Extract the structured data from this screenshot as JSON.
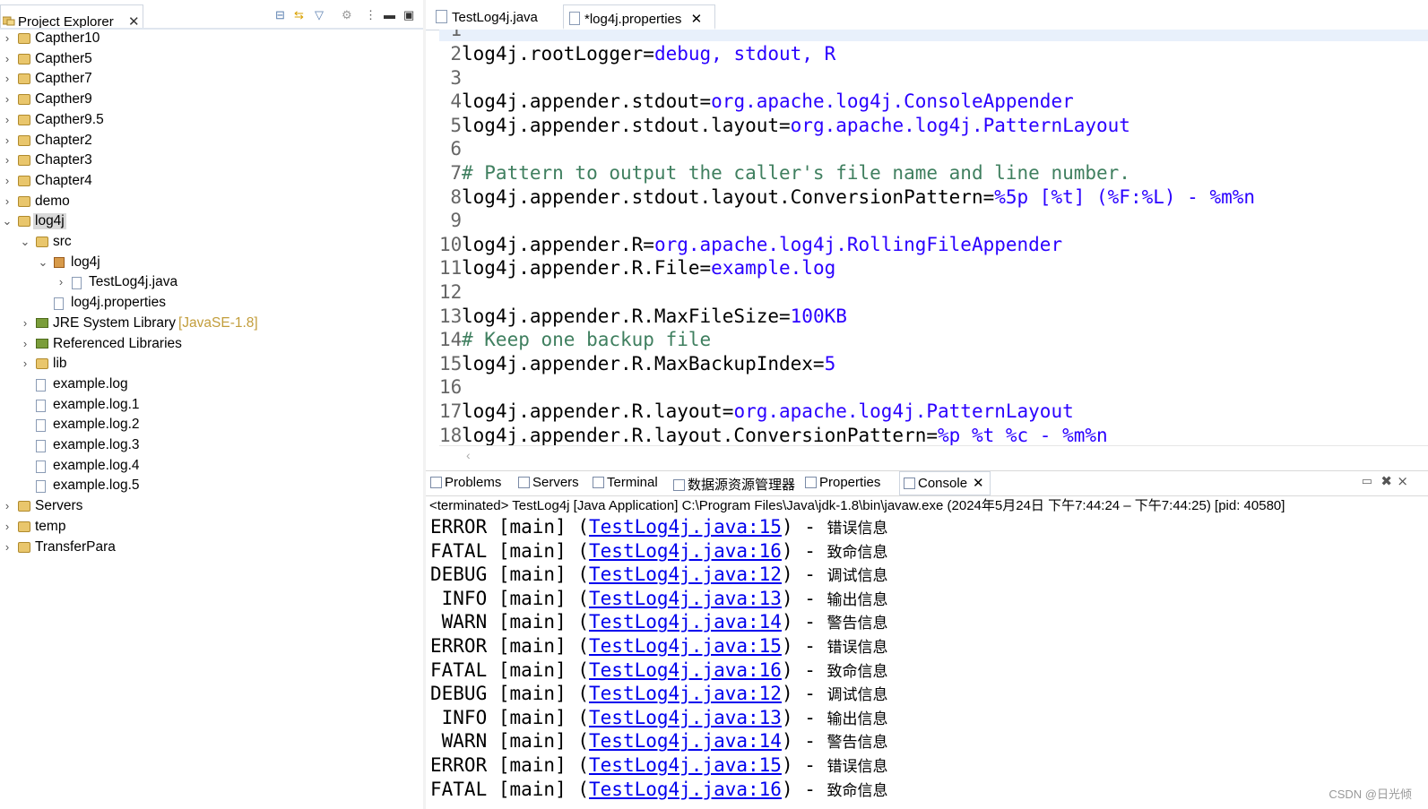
{
  "explorer": {
    "title": "Project Explorer",
    "items": [
      {
        "label": "Capther10",
        "arrow": "›",
        "indent": 0,
        "kind": "project"
      },
      {
        "label": "Capther5",
        "arrow": "›",
        "indent": 0,
        "kind": "project"
      },
      {
        "label": "Capther7",
        "arrow": "›",
        "indent": 0,
        "kind": "project"
      },
      {
        "label": "Capther9",
        "arrow": "›",
        "indent": 0,
        "kind": "project"
      },
      {
        "label": "Capther9.5",
        "arrow": "›",
        "indent": 0,
        "kind": "project"
      },
      {
        "label": "Chapter2",
        "arrow": "›",
        "indent": 0,
        "kind": "project"
      },
      {
        "label": "Chapter3",
        "arrow": "›",
        "indent": 0,
        "kind": "project"
      },
      {
        "label": "Chapter4",
        "arrow": "›",
        "indent": 0,
        "kind": "project"
      },
      {
        "label": "demo",
        "arrow": "›",
        "indent": 0,
        "kind": "project"
      },
      {
        "label": "log4j",
        "arrow": "⌄",
        "indent": 0,
        "kind": "project",
        "selected": true
      },
      {
        "label": "src",
        "arrow": "⌄",
        "indent": 1,
        "kind": "srcfolder"
      },
      {
        "label": "log4j",
        "arrow": "⌄",
        "indent": 2,
        "kind": "package"
      },
      {
        "label": "TestLog4j.java",
        "arrow": "›",
        "indent": 3,
        "kind": "java"
      },
      {
        "label": "log4j.properties",
        "arrow": "",
        "indent": 2,
        "kind": "file"
      },
      {
        "label": "JRE System Library",
        "deco": "[JavaSE-1.8]",
        "arrow": "›",
        "indent": 1,
        "kind": "library"
      },
      {
        "label": "Referenced Libraries",
        "arrow": "›",
        "indent": 1,
        "kind": "library"
      },
      {
        "label": "lib",
        "arrow": "›",
        "indent": 1,
        "kind": "folder"
      },
      {
        "label": "example.log",
        "arrow": "",
        "indent": 1,
        "kind": "file"
      },
      {
        "label": "example.log.1",
        "arrow": "",
        "indent": 1,
        "kind": "file"
      },
      {
        "label": "example.log.2",
        "arrow": "",
        "indent": 1,
        "kind": "file"
      },
      {
        "label": "example.log.3",
        "arrow": "",
        "indent": 1,
        "kind": "file"
      },
      {
        "label": "example.log.4",
        "arrow": "",
        "indent": 1,
        "kind": "file"
      },
      {
        "label": "example.log.5",
        "arrow": "",
        "indent": 1,
        "kind": "file"
      },
      {
        "label": "Servers",
        "arrow": "›",
        "indent": 0,
        "kind": "project"
      },
      {
        "label": "temp",
        "arrow": "›",
        "indent": 0,
        "kind": "project"
      },
      {
        "label": "TransferPara",
        "arrow": "›",
        "indent": 0,
        "kind": "project"
      }
    ]
  },
  "editor": {
    "tabs": [
      {
        "label": "TestLog4j.java",
        "active": false
      },
      {
        "label": "*log4j.properties",
        "active": true
      }
    ],
    "lines": [
      {
        "n": "2",
        "parts": [
          [
            "key",
            "log4j.rootLogger="
          ],
          [
            "val",
            "debug, stdout, R"
          ]
        ]
      },
      {
        "n": "3",
        "parts": []
      },
      {
        "n": "4",
        "parts": [
          [
            "key",
            "log4j.appender.stdout="
          ],
          [
            "val",
            "org.apache.log4j.ConsoleAppender"
          ]
        ]
      },
      {
        "n": "5",
        "parts": [
          [
            "key",
            "log4j.appender.stdout.layout="
          ],
          [
            "val",
            "org.apache.log4j.PatternLayout"
          ]
        ]
      },
      {
        "n": "6",
        "parts": []
      },
      {
        "n": "7",
        "parts": [
          [
            "cmt",
            "# Pattern to output the caller's file name and line number."
          ]
        ]
      },
      {
        "n": "8",
        "parts": [
          [
            "key",
            "log4j.appender.stdout.layout.ConversionPattern="
          ],
          [
            "val",
            "%5p [%t] (%F:%L) - %m%n"
          ]
        ]
      },
      {
        "n": "9",
        "parts": []
      },
      {
        "n": "10",
        "parts": [
          [
            "key",
            "log4j.appender.R="
          ],
          [
            "val",
            "org.apache.log4j.RollingFileAppender"
          ]
        ]
      },
      {
        "n": "11",
        "parts": [
          [
            "key",
            "log4j.appender.R.File="
          ],
          [
            "val",
            "example.log"
          ]
        ]
      },
      {
        "n": "12",
        "parts": []
      },
      {
        "n": "13",
        "parts": [
          [
            "key",
            "log4j.appender.R.MaxFileSize="
          ],
          [
            "val",
            "100KB"
          ]
        ]
      },
      {
        "n": "14",
        "parts": [
          [
            "cmt",
            "# Keep one backup file"
          ]
        ]
      },
      {
        "n": "15",
        "parts": [
          [
            "key",
            "log4j.appender.R.MaxBackupIndex="
          ],
          [
            "val",
            "5"
          ]
        ]
      },
      {
        "n": "16",
        "parts": []
      },
      {
        "n": "17",
        "parts": [
          [
            "key",
            "log4j.appender.R.layout="
          ],
          [
            "val",
            "org.apache.log4j.PatternLayout"
          ]
        ]
      },
      {
        "n": "18",
        "parts": [
          [
            "key",
            "log4j.appender.R.layout.ConversionPattern="
          ],
          [
            "val",
            "%p %t %c - %m%n"
          ]
        ]
      }
    ]
  },
  "bottom": {
    "tabs": [
      {
        "label": "Problems",
        "icon": "problems-icon"
      },
      {
        "label": "Servers",
        "icon": "servers-icon"
      },
      {
        "label": "Terminal",
        "icon": "terminal-icon"
      },
      {
        "label": "数据源资源管理器",
        "icon": "datasource-icon"
      },
      {
        "label": "Properties",
        "icon": "properties-icon"
      },
      {
        "label": "Console",
        "icon": "console-icon",
        "active": true
      }
    ],
    "status": "<terminated> TestLog4j [Java Application] C:\\Program Files\\Java\\jdk-1.8\\bin\\javaw.exe  (2024年5月24日 下午7:44:24 – 下午7:44:25) [pid: 40580]",
    "console": [
      {
        "level": "ERROR",
        "thread": " [main] (",
        "link": "TestLog4j.java:15",
        "msg": "错误信息"
      },
      {
        "level": "FATAL",
        "thread": " [main] (",
        "link": "TestLog4j.java:16",
        "msg": "致命信息"
      },
      {
        "level": "DEBUG",
        "thread": " [main] (",
        "link": "TestLog4j.java:12",
        "msg": "调试信息"
      },
      {
        "level": " INFO",
        "thread": " [main] (",
        "link": "TestLog4j.java:13",
        "msg": "输出信息"
      },
      {
        "level": " WARN",
        "thread": " [main] (",
        "link": "TestLog4j.java:14",
        "msg": "警告信息"
      },
      {
        "level": "ERROR",
        "thread": " [main] (",
        "link": "TestLog4j.java:15",
        "msg": "错误信息"
      },
      {
        "level": "FATAL",
        "thread": " [main] (",
        "link": "TestLog4j.java:16",
        "msg": "致命信息"
      },
      {
        "level": "DEBUG",
        "thread": " [main] (",
        "link": "TestLog4j.java:12",
        "msg": "调试信息"
      },
      {
        "level": " INFO",
        "thread": " [main] (",
        "link": "TestLog4j.java:13",
        "msg": "输出信息"
      },
      {
        "level": " WARN",
        "thread": " [main] (",
        "link": "TestLog4j.java:14",
        "msg": "警告信息"
      },
      {
        "level": "ERROR",
        "thread": " [main] (",
        "link": "TestLog4j.java:15",
        "msg": "错误信息"
      },
      {
        "level": "FATAL",
        "thread": " [main] (",
        "link": "TestLog4j.java:16",
        "msg": "致命信息"
      }
    ],
    "separator": ") - "
  },
  "watermark": "CSDN @日光倾",
  "colors": {
    "keyword": "#000000",
    "value": "#2a00ff",
    "comment": "#3f7f5f",
    "link": "#0000ee",
    "selection": "#d9d9d9"
  }
}
